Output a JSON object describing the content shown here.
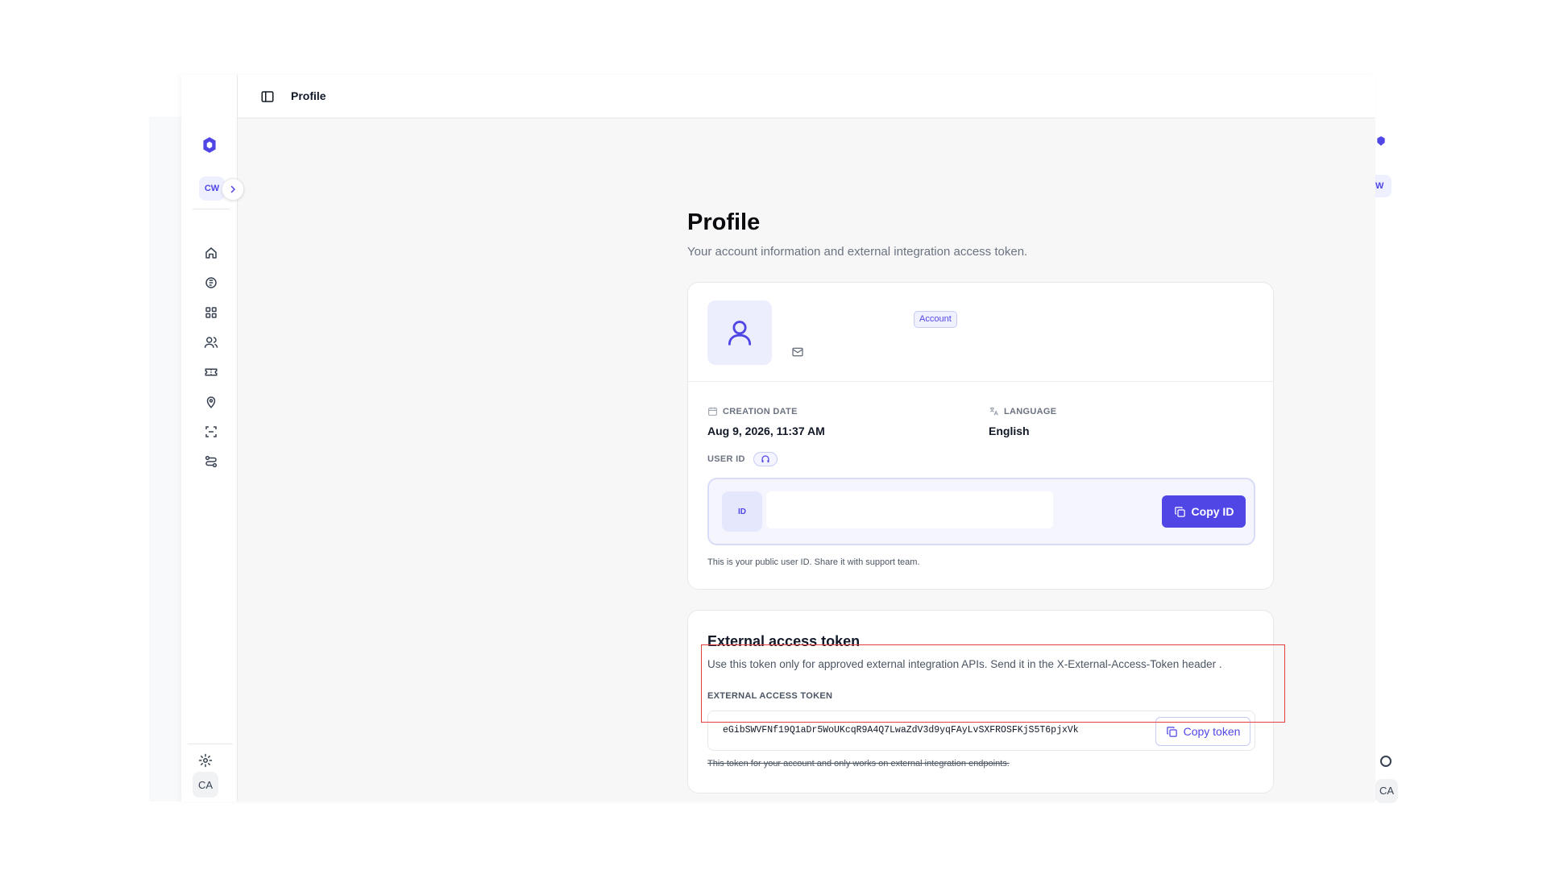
{
  "topbar": {
    "title": "Profile"
  },
  "sidebar": {
    "workspace_badge": "CW",
    "user_badge": "CA",
    "items": [
      {
        "icon": "home-icon"
      },
      {
        "icon": "documents-icon"
      },
      {
        "icon": "dashboard-icon"
      },
      {
        "icon": "users-icon"
      },
      {
        "icon": "ticket-icon"
      },
      {
        "icon": "location-icon"
      },
      {
        "icon": "scan-icon"
      },
      {
        "icon": "workflow-icon"
      }
    ],
    "settings_icon": "gear-icon"
  },
  "ghost": {
    "workspace_badge": "W",
    "user_badge": "CA"
  },
  "page": {
    "title": "Profile",
    "subtitle": "Your account information and external integration access token."
  },
  "account": {
    "badge": "Account",
    "creation_date_label": "CREATION DATE",
    "creation_date": "Aug 9, 2026, 11:37 AM",
    "language_label": "LANGUAGE",
    "language": "English",
    "user_id_label": "USER ID",
    "id_chip": "ID",
    "user_id_value": "",
    "copy_id_label": "Copy ID",
    "hint": "This is your public user ID. Share it with support team."
  },
  "token": {
    "title": "External access token",
    "description": "Use this token only for approved external integration APIs. Send it in the X-External-Access-Token header .",
    "label": "EXTERNAL ACCESS TOKEN",
    "value": "eGibSWVFNf19Q1aDr5WoUKcqR9A4Q7LwaZdV3d9yqFAyLvSXFROSFKjS5T6pjxVk",
    "copy_label": "Copy token",
    "note": "This token for your account and only works on external integration endpoints."
  },
  "colors": {
    "accent": "#4f46e5",
    "highlight": "#e53e3e"
  }
}
